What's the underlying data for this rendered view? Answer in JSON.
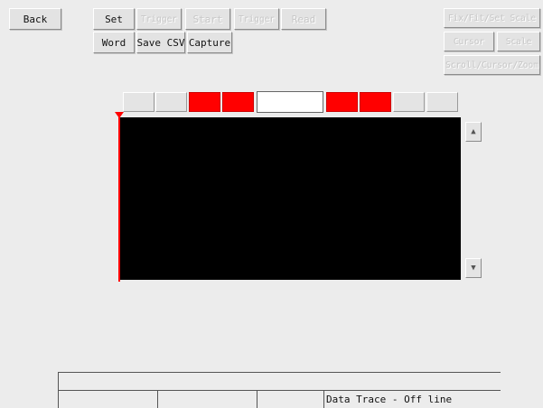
{
  "toolbar": {
    "back": "Back",
    "set": "Set",
    "trigger1": "Trigger",
    "start": "Start",
    "trigger2": "Trigger",
    "read": "Read",
    "word": "Word",
    "save_csv": "Save CSV",
    "capture": "Capture"
  },
  "right_panel": {
    "top": "Fix/Fit/Set Scale",
    "btn_a": "Cursor",
    "btn_b": "Scale",
    "bottom": "Scroll/Cursor/Zoom"
  },
  "status": {
    "cell1": "",
    "cell2": "",
    "cell3": "",
    "trace_status": "Data Trace - Off line"
  },
  "colors": {
    "background": "#ececec",
    "plot_background": "#000000",
    "cursor": "#ff0000",
    "active_segment": "#ff0000"
  }
}
